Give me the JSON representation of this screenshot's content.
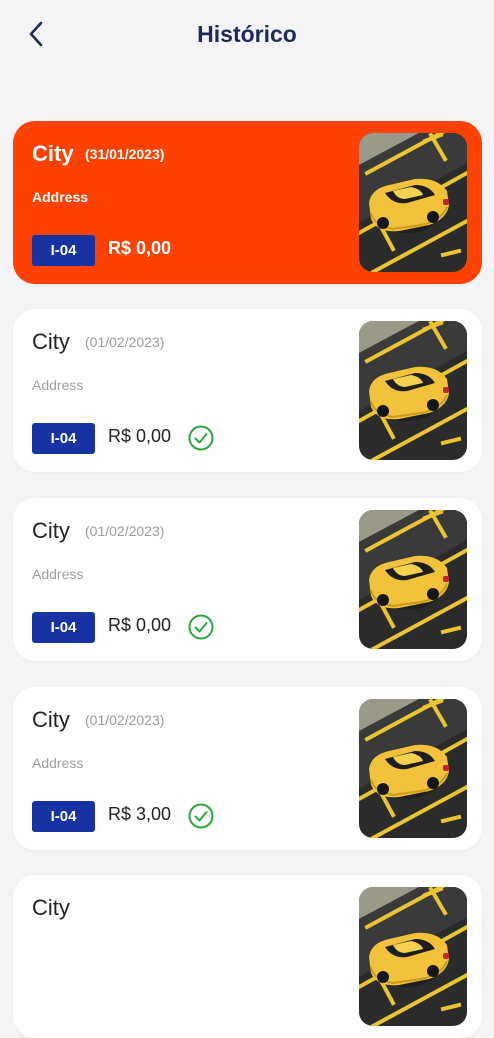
{
  "header": {
    "title": "Histórico",
    "back_icon": "chevron-left-icon"
  },
  "colors": {
    "accent": "#ff4200",
    "badge": "#1633a1",
    "title": "#1d2a55",
    "check": "#2aa63a",
    "background": "#f4f4f6"
  },
  "history": [
    {
      "city": "City",
      "date": "(31/01/2023)",
      "address": "Address",
      "spot": "I-04",
      "price": "R$ 0,00",
      "active": true,
      "paid": false
    },
    {
      "city": "City",
      "date": "(01/02/2023)",
      "address": "Address",
      "spot": "I-04",
      "price": "R$ 0,00",
      "active": false,
      "paid": true
    },
    {
      "city": "City",
      "date": "(01/02/2023)",
      "address": "Address",
      "spot": "I-04",
      "price": "R$ 0,00",
      "active": false,
      "paid": true
    },
    {
      "city": "City",
      "date": "(01/02/2023)",
      "address": "Address",
      "spot": "I-04",
      "price": "R$ 3,00",
      "active": false,
      "paid": true
    },
    {
      "city": "City",
      "date": "",
      "address": "",
      "spot": "",
      "price": "",
      "active": false,
      "paid": false
    }
  ]
}
